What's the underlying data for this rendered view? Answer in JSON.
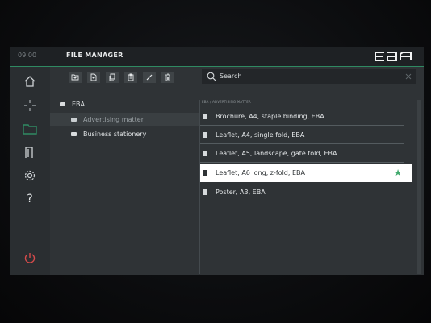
{
  "topbar": {
    "time": "09:00",
    "title": "FILE MANAGER",
    "logo": "EBA"
  },
  "sidebar": {
    "items": [
      {
        "name": "home-icon"
      },
      {
        "name": "crosshair-icon"
      },
      {
        "name": "folder-icon",
        "active": true
      },
      {
        "name": "door-icon"
      },
      {
        "name": "gear-icon"
      },
      {
        "name": "help-icon",
        "label": "?"
      },
      {
        "name": "power-icon"
      }
    ]
  },
  "toolbar": {
    "buttons": [
      "new-folder-icon",
      "new-document-icon",
      "copy-icon",
      "paste-icon",
      "rename-icon",
      "delete-icon"
    ]
  },
  "search": {
    "placeholder": "Search"
  },
  "tree": {
    "root": "EBA",
    "children": [
      "Advertising matter",
      "Business stationery"
    ],
    "selected": "Advertising matter"
  },
  "files": {
    "breadcrumb": "EBA / ADVERTISING MATTER",
    "items": [
      {
        "label": "Brochure, A4, staple binding, EBA"
      },
      {
        "label": "Leaflet, A4, single fold, EBA"
      },
      {
        "label": "Leaflet, A5, landscape, gate fold, EBA"
      },
      {
        "label": "Leaflet, A6 long, z-fold, EBA",
        "selected": true,
        "favorite": true
      },
      {
        "label": "Poster, A3, EBA"
      }
    ]
  },
  "colors": {
    "accent": "#2f8a62",
    "star": "#3ea86b",
    "power": "#d64b4b"
  }
}
